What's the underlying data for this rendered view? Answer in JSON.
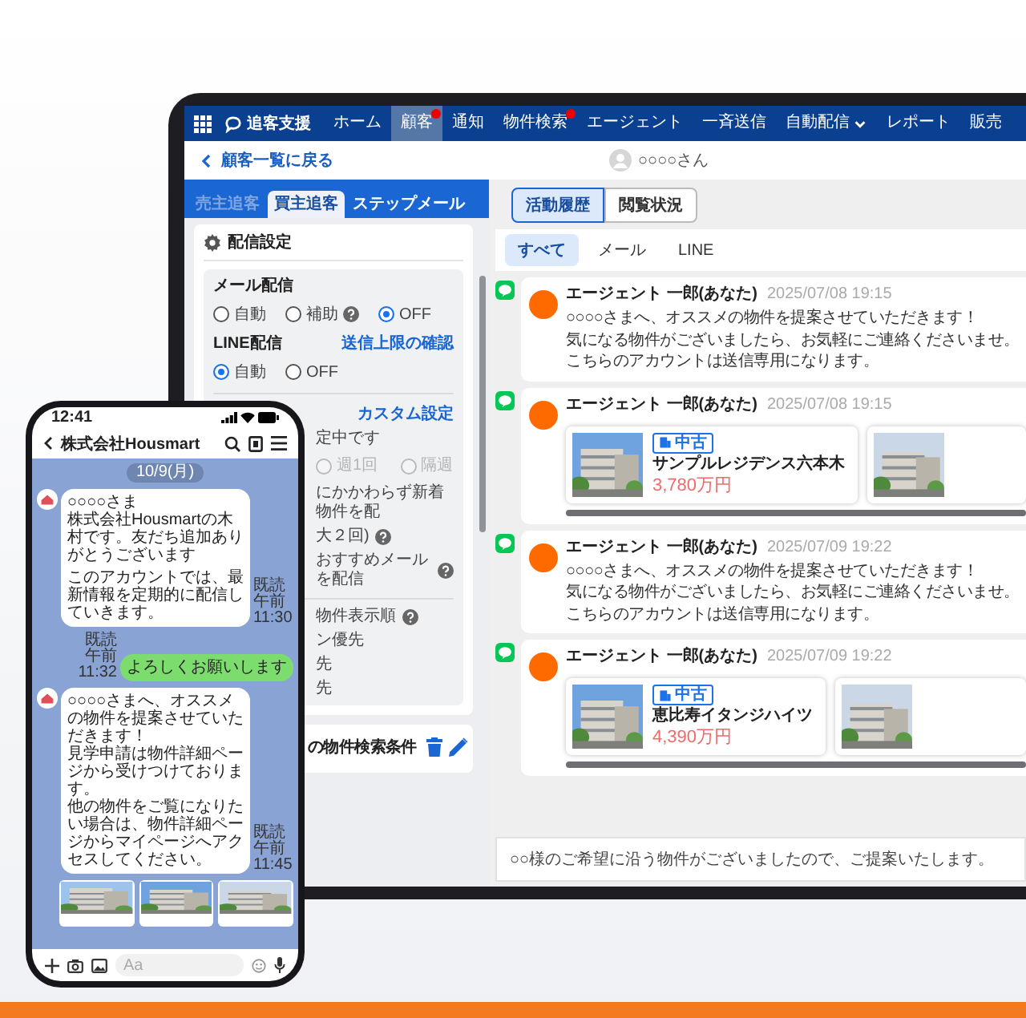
{
  "nav": {
    "logo": "追客支援",
    "items": [
      {
        "label": "ホーム",
        "selected": false,
        "badge": false,
        "dropdown": false
      },
      {
        "label": "顧客",
        "selected": true,
        "badge": true,
        "dropdown": false
      },
      {
        "label": "通知",
        "selected": false,
        "badge": false,
        "dropdown": false
      },
      {
        "label": "物件検索",
        "selected": false,
        "badge": true,
        "dropdown": false
      },
      {
        "label": "エージェント",
        "selected": false,
        "badge": false,
        "dropdown": false
      },
      {
        "label": "一斉送信",
        "selected": false,
        "badge": false,
        "dropdown": false
      },
      {
        "label": "自動配信",
        "selected": false,
        "badge": false,
        "dropdown": true
      },
      {
        "label": "レポート",
        "selected": false,
        "badge": false,
        "dropdown": false
      },
      {
        "label": "販売",
        "selected": false,
        "badge": false,
        "dropdown": false
      }
    ]
  },
  "header": {
    "back": "顧客一覧に戻る",
    "customer": "○○○○さん"
  },
  "left_tabs": [
    {
      "label": "売主追客",
      "selected": false,
      "disabled": true
    },
    {
      "label": "買主追客",
      "selected": true,
      "disabled": false
    },
    {
      "label": "ステップメール",
      "selected": false,
      "disabled": false
    }
  ],
  "settings": {
    "title": "配信設定",
    "mail": {
      "label": "メール配信",
      "options": [
        {
          "label": "自動",
          "selected": false,
          "help": false
        },
        {
          "label": "補助",
          "selected": false,
          "help": true
        },
        {
          "label": "OFF",
          "selected": true,
          "help": false
        }
      ]
    },
    "line": {
      "label": "LINE配信",
      "link": "送信上限の確認",
      "options": [
        {
          "label": "自動",
          "selected": true,
          "help": false
        },
        {
          "label": "OFF",
          "selected": false,
          "help": false
        }
      ]
    },
    "custom_link": "カスタム設定",
    "status": "定中です",
    "frequency": {
      "disabled": true,
      "options": [
        {
          "label": "週1回",
          "selected": false
        },
        {
          "label": "隔週",
          "selected": false
        }
      ]
    },
    "notes": [
      {
        "text": "にかかわらず新着物件を配",
        "help": false
      },
      {
        "text": "大２回)",
        "help": true
      },
      {
        "text": "おすすめメールを配信",
        "help": true
      }
    ],
    "sort": {
      "label": "物件表示順",
      "options": [
        "ン優先",
        "先",
        "先"
      ]
    }
  },
  "search_card": {
    "title": "の物件検索条件"
  },
  "view_toggle": [
    {
      "label": "活動履歴",
      "selected": true
    },
    {
      "label": "閲覧状況",
      "selected": false
    }
  ],
  "filters": [
    {
      "label": "すべて",
      "selected": true
    },
    {
      "label": "メール",
      "selected": false
    },
    {
      "label": "LINE",
      "selected": false
    }
  ],
  "timeline": [
    {
      "kind": "message",
      "author": "エージェント 一郎(あなた)",
      "time": "2025/07/08 19:15",
      "lines": [
        "○○○○さまへ、オススメの物件を提案させていただきます！",
        "気になる物件がございましたら、お気軽にご連絡くださいませ。",
        "こちらのアカウントは送信専用になります。"
      ]
    },
    {
      "kind": "properties",
      "author": "エージェント 一郎(あなた)",
      "time": "2025/07/08 19:15",
      "properties": [
        {
          "kind": "full",
          "tag": "中古",
          "name": "サンプルレジデンス六本木",
          "price": "3,780万円"
        },
        {
          "kind": "picture"
        }
      ]
    },
    {
      "kind": "message",
      "author": "エージェント 一郎(あなた)",
      "time": "2025/07/09 19:22",
      "lines": [
        "○○○○さまへ、オススメの物件を提案させていただきます！",
        "気になる物件がございましたら、お気軽にご連絡くださいませ。",
        "こちらのアカウントは送信専用になります。"
      ]
    },
    {
      "kind": "properties",
      "author": "エージェント 一郎(あなた)",
      "time": "2025/07/09 19:22",
      "properties": [
        {
          "kind": "full",
          "tag": "中古",
          "name": "恵比寿イタンジハイツ",
          "price": "4,390万円"
        },
        {
          "kind": "picture"
        }
      ]
    }
  ],
  "composer": {
    "value": "○○様のご希望に沿う物件がございましたので、ご提案いたします。"
  },
  "phone": {
    "time": "12:41",
    "chat_title": "株式会社Housmart",
    "date": "10/9(月)",
    "messages": [
      {
        "kind": "incoming",
        "paragraphs": [
          [
            "○○○○さま",
            "株式会社Housmartの木村です。友だち追加ありがとうございます"
          ],
          [
            "このアカウントでは、最新情報を定期的に配信していきます。"
          ]
        ],
        "read": "既読",
        "time": "午前11:30"
      },
      {
        "kind": "outgoing",
        "paragraphs": [
          [
            "よろしくお願いします"
          ]
        ],
        "read": "既読",
        "time": "午前11:32"
      },
      {
        "kind": "incoming",
        "paragraphs": [
          [
            "○○○○さまへ、オススメの物件を提案させていただきます！",
            "見学申請は物件詳細ページから受けつけております。",
            "他の物件をご覧になりたい場合は、物件詳細ページからマイページへアクセスしてください。"
          ]
        ],
        "read": "既読",
        "time": "午前11:45"
      }
    ],
    "cards": [
      {
        "kind": "picture"
      },
      {
        "kind": "picture"
      },
      {
        "kind": "picture"
      }
    ],
    "placeholder": "Aa"
  }
}
